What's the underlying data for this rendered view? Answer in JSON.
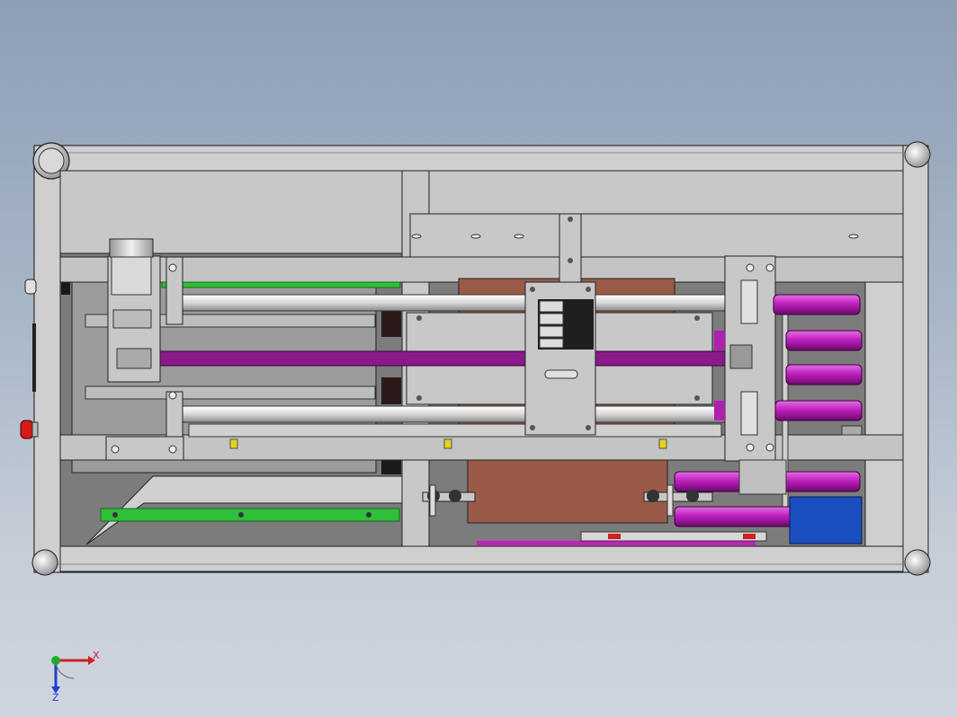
{
  "viewport": {
    "background_top": "#8d9fb5",
    "background_bottom": "#cfd5de"
  },
  "model": {
    "view": "top",
    "colors": {
      "frame": "#c8c8c8",
      "frame_edge": "#222222",
      "shaft": "#e6e6e6",
      "belt": "#8a1a8a",
      "roller": "#c020c0",
      "plate_brown": "#9a5a48",
      "rail_green": "#2fbf3a",
      "motor_blue": "#1a4fc0",
      "block_dark": "#1e1e1e",
      "bolt_yellow": "#e8d020"
    }
  },
  "triad": {
    "x_label": "X",
    "z_label": "Z",
    "x_color": "#d02020",
    "y_color": "#20b020",
    "z_color": "#2040d0"
  }
}
